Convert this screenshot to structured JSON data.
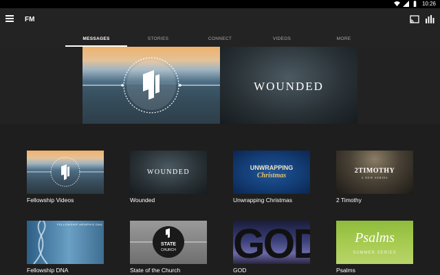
{
  "status_bar": {
    "time": "10:26"
  },
  "app_bar": {
    "title": "FM",
    "menu_icon": "hamburger-menu-icon",
    "cast_icon": "cast-icon",
    "stats_icon": "bar-chart-icon"
  },
  "tabs": [
    {
      "label": "MESSAGES",
      "active": true
    },
    {
      "label": "STORIES",
      "active": false
    },
    {
      "label": "CONNECT",
      "active": false
    },
    {
      "label": "VIDEOS",
      "active": false
    },
    {
      "label": "MORE",
      "active": false
    }
  ],
  "hero": [
    {
      "text": ""
    },
    {
      "text": "WOUNDED"
    }
  ],
  "tiles": [
    {
      "label": "Fellowship Videos",
      "thumb_text": ""
    },
    {
      "label": "Wounded",
      "thumb_text": "WOUNDED"
    },
    {
      "label": "Unwrapping Christmas",
      "thumb_text_1": "UNWRAPPING",
      "thumb_text_2": "Christmas"
    },
    {
      "label": "2 Timothy",
      "thumb_text_1": "2TIMOTHY",
      "thumb_text_2": "A NEW SERIES"
    },
    {
      "label": "Fellowship DNA",
      "thumb_text": "FELLOWSHIP MEMPHIS DNA"
    },
    {
      "label": "State of the Church",
      "thumb_text_1": "STATE",
      "thumb_text_2": "CHURCH"
    },
    {
      "label": "GOD",
      "thumb_text": "GOD"
    },
    {
      "label": "Psalms",
      "thumb_text_1": "Psalms",
      "thumb_text_2": "SUMMER SERIES"
    }
  ]
}
